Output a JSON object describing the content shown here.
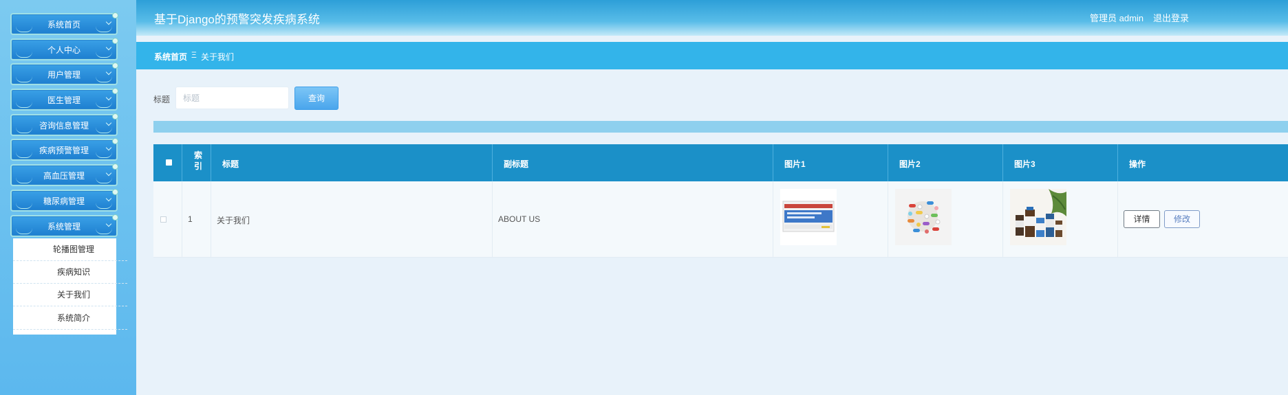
{
  "sidebar": {
    "items": [
      {
        "label": "系统首页"
      },
      {
        "label": "个人中心"
      },
      {
        "label": "用户管理"
      },
      {
        "label": "医生管理"
      },
      {
        "label": "咨询信息管理"
      },
      {
        "label": "疾病预警管理"
      },
      {
        "label": "高血压管理"
      },
      {
        "label": "糖尿病管理"
      },
      {
        "label": "系统管理"
      }
    ],
    "submenu": [
      {
        "label": "轮播图管理"
      },
      {
        "label": "疾病知识"
      },
      {
        "label": "关于我们"
      },
      {
        "label": "系统简介"
      }
    ]
  },
  "header": {
    "title": "基于Django的预警突发疾病系统",
    "user": "管理员 admin",
    "logout": "退出登录"
  },
  "breadcrumb": {
    "home": "系统首页",
    "separator": "Ξ",
    "current": "关于我们"
  },
  "search": {
    "label": "标题",
    "placeholder": "标题",
    "value": "",
    "button": "查询"
  },
  "table": {
    "columns": {
      "index": "索引",
      "title": "标题",
      "subtitle": "副标题",
      "pic1": "图片1",
      "pic2": "图片2",
      "pic3": "图片3",
      "actions": "操作"
    },
    "rows": [
      {
        "index": "1",
        "title": "关于我们",
        "subtitle": "ABOUT US",
        "detail": "详情",
        "edit": "修改"
      }
    ]
  },
  "colors": {
    "sidebar": "#5cb8ee",
    "header": "#2d9fd8",
    "breadcrumb": "#33b4ea",
    "table_header": "#1b90c8",
    "button": "#4aa6ec"
  }
}
